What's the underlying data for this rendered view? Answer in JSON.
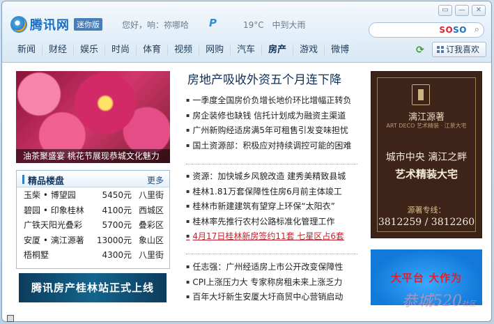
{
  "header": {
    "logo_text": "腾讯网",
    "logo_badge": "迷你版",
    "greeting": "您好，响：祢哪哈",
    "weather": {
      "temperature": "19°C",
      "condition": "中到大雨"
    },
    "window_controls": {
      "skin": "▭",
      "minimize": "—",
      "close": "✕"
    },
    "search": {
      "brand_red": "SO",
      "brand_blue": "SO"
    },
    "nav": [
      "新闻",
      "财经",
      "娱乐",
      "时尚",
      "体育",
      "视频",
      "网购",
      "汽车",
      "房产",
      "游戏",
      "微博"
    ],
    "active_nav": "房产",
    "custom_button": "订我喜欢"
  },
  "banner": {
    "caption": "油茶聚盛宴 桃花节展现恭城文化魅力"
  },
  "market": {
    "title": "精品楼盘",
    "more": "更多",
    "rows": [
      {
        "name": "玉柴 • 博望园",
        "price": "5450元",
        "district": "八里街"
      },
      {
        "name": "碧园 • 印象桂林",
        "price": "4100元",
        "district": "西城区"
      },
      {
        "name": "广铁天阳光叠彩",
        "price": "5700元",
        "district": "叠彩区"
      },
      {
        "name": "安厦 • 漓江源著",
        "price": "13000元",
        "district": "象山区"
      },
      {
        "name": "梧桐墅",
        "price": "4300元",
        "district": "八里街"
      }
    ]
  },
  "launch_banner": "腾讯房产桂林站正式上线",
  "headline": "房地产吸收外资五个月连下降",
  "news_group_1": [
    "一季度全国房价负增长地价环比增幅正转负",
    "房企装修也缺钱 信托计划成为融资主渠道",
    "广州新购经适房满5年可租售引发变味担忧",
    "国土资源部：积极应对持续调控可能的困难"
  ],
  "news_group_2": [
    "资源：加快城乡风貌改造 建秀美精致县城",
    "桂林1.81万套保障性住房6月前主体竣工",
    "桂林市新建建筑有望穿上环保“太阳衣”",
    "桂林率先推行农村公路标准化管理工作"
  ],
  "news_red": "4月17日桂林新房签约11套 七星区占6套",
  "news_group_3": [
    "任志强：广州经适房上市公开改变保障性",
    "CPI上涨压力大 专家称房租未来上涨乏力",
    "百年大圩新生安厦大圩商贸中心营销启动"
  ],
  "ad_top": {
    "brand": "漓江源著",
    "brand_sub": "ART DECO 艺术精装 · 江景大宅",
    "slogan": "城市中央 漓江之畔",
    "slogan2": "艺术精装大宅",
    "hotline_label": "源著专线：",
    "hotline": "3812259 / 3812260"
  },
  "ad_bottom": "大平台 大作为",
  "watermark": {
    "text": "恭城520",
    "suffix": "社区"
  }
}
